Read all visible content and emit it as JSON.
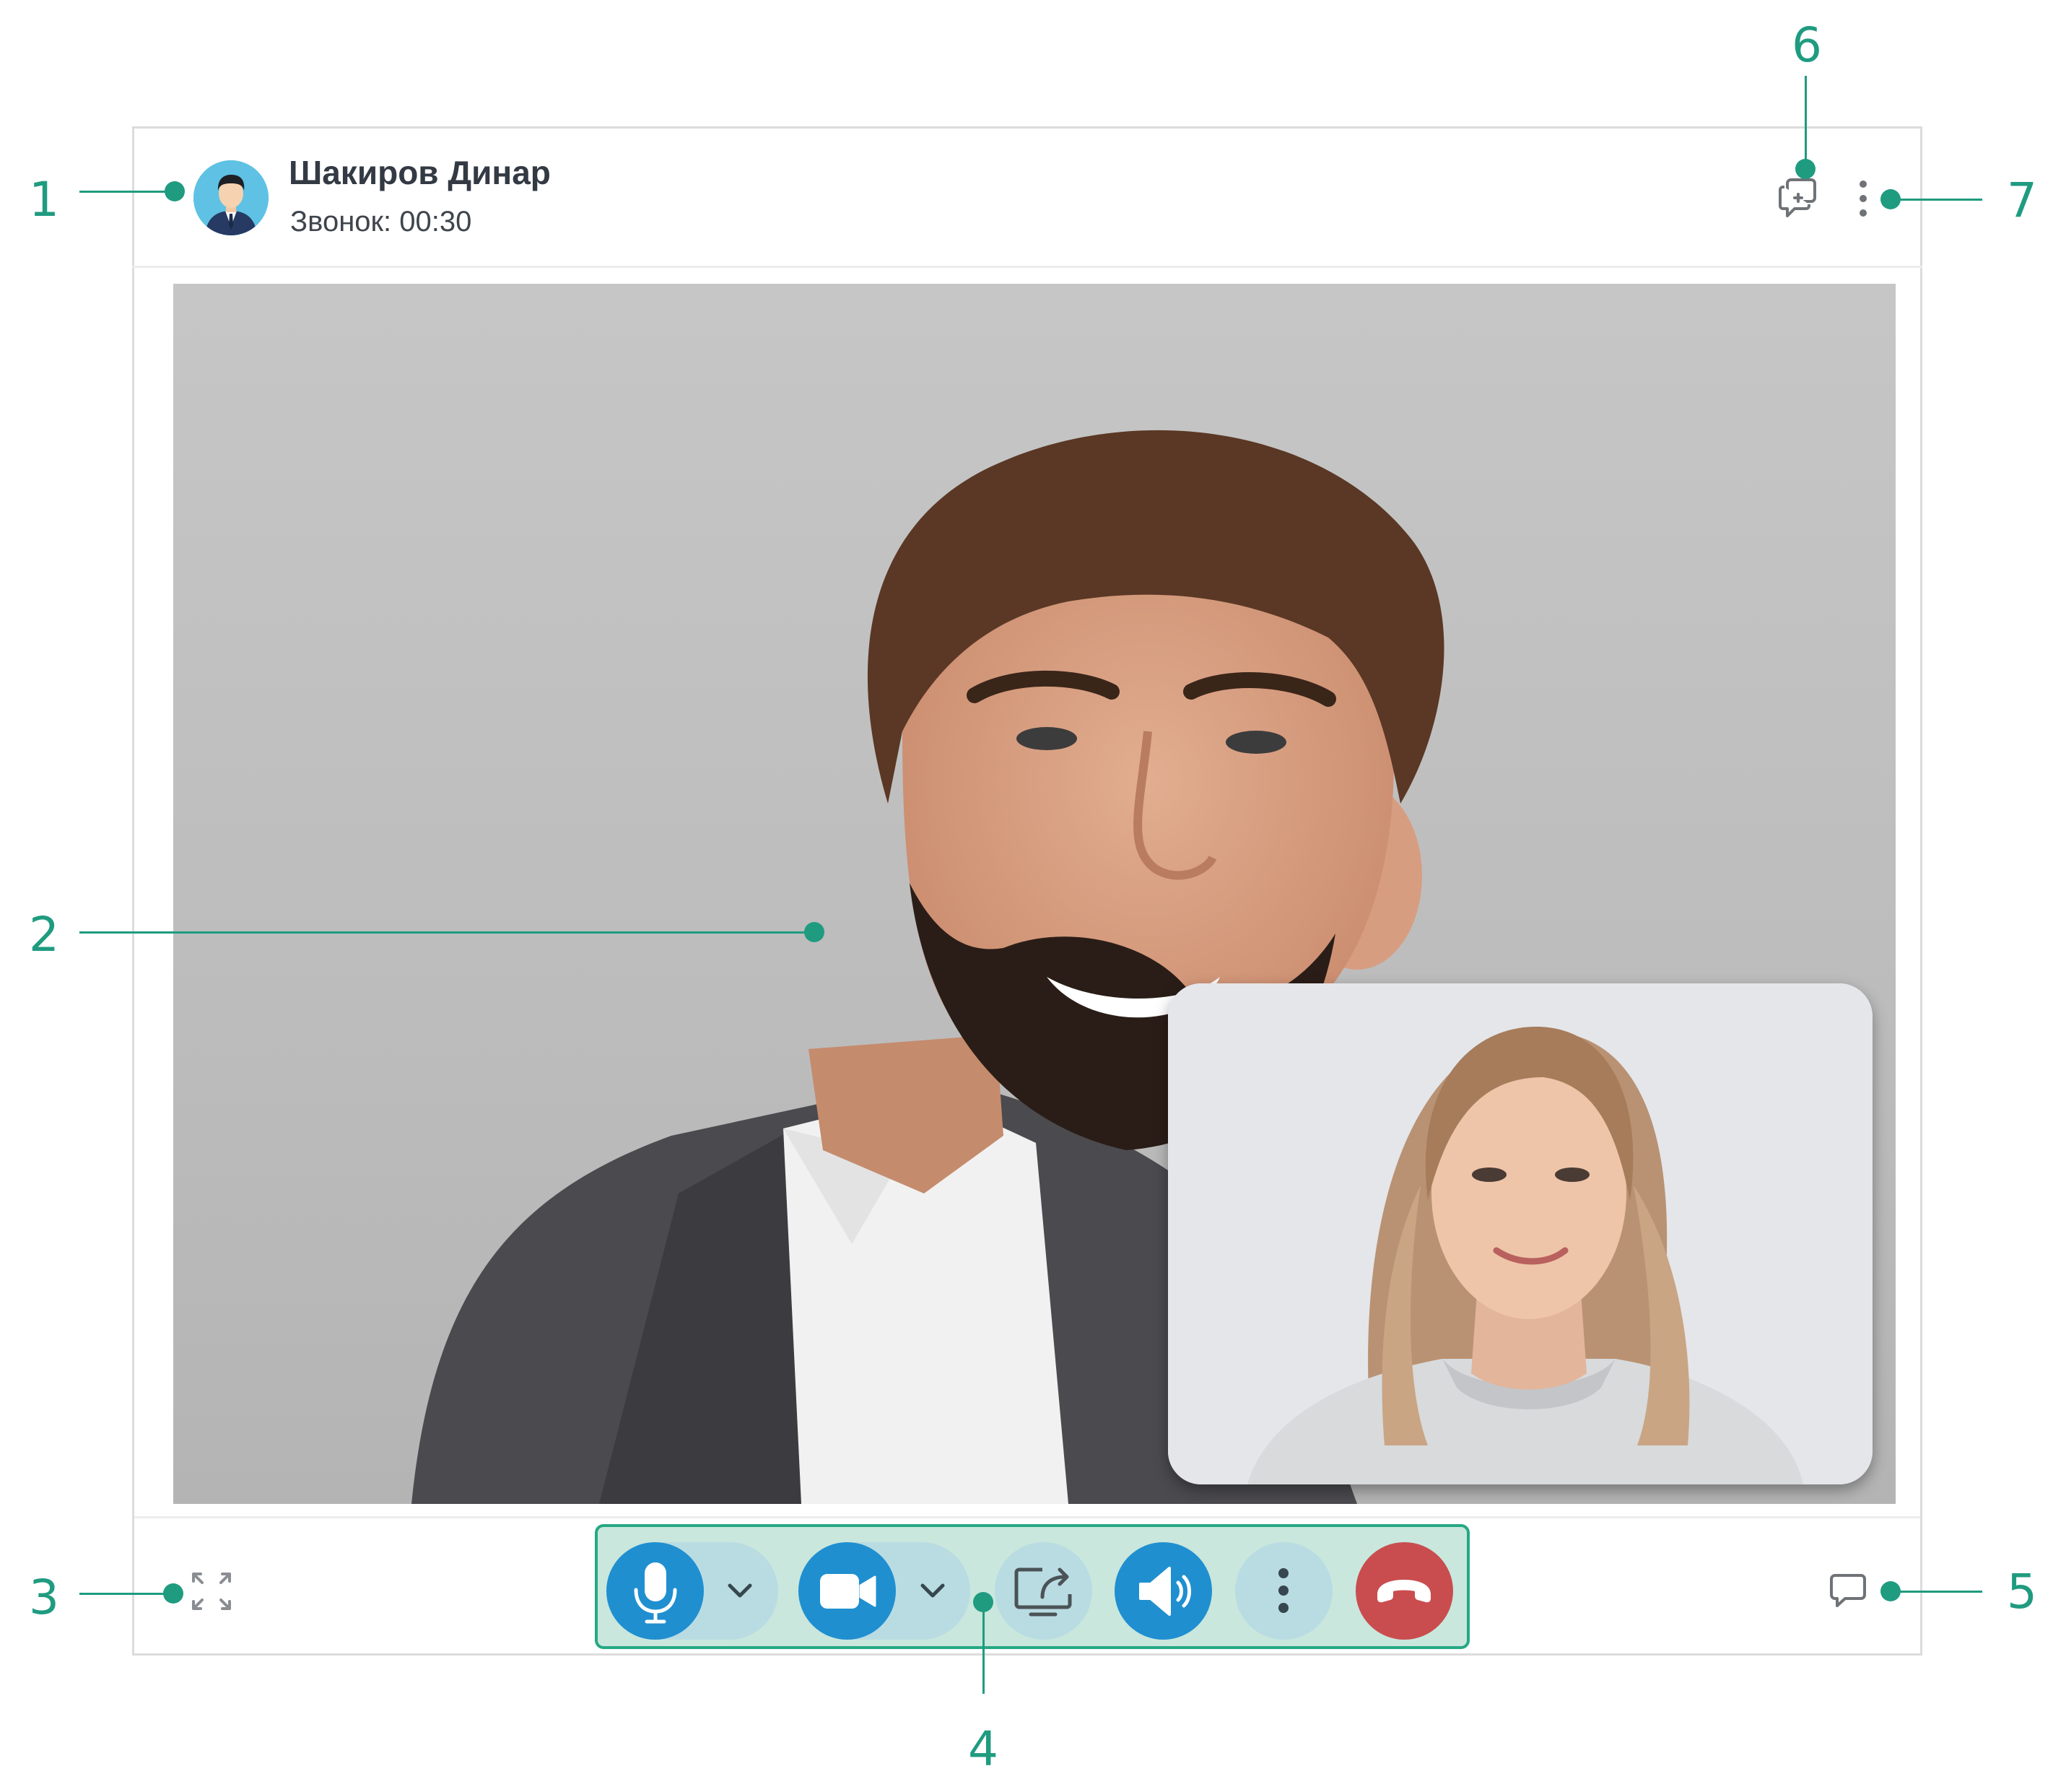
{
  "call": {
    "contact_name": "Шакиров Динар",
    "status": "Звонок: 00:30"
  },
  "icons": {
    "avatar": "user-avatar",
    "participants": "add-participant-icon",
    "header_menu": "vertical-dots-icon",
    "fullscreen": "expand-icon",
    "chat": "chat-bubble-icon",
    "microphone": "microphone-icon",
    "camera": "video-camera-icon",
    "screen_share": "screen-share-icon",
    "speaker": "speaker-icon",
    "more": "vertical-dots-icon",
    "hangup": "phone-hangup-icon"
  },
  "colors": {
    "accent": "#1f9b80",
    "control_blue": "#1f8fd0",
    "control_bg": "#b9dce2",
    "panel_bg": "#c9e7dd",
    "hangup_red": "#c94d4f"
  },
  "annotations": [
    "1",
    "2",
    "3",
    "4",
    "5",
    "6",
    "7"
  ]
}
